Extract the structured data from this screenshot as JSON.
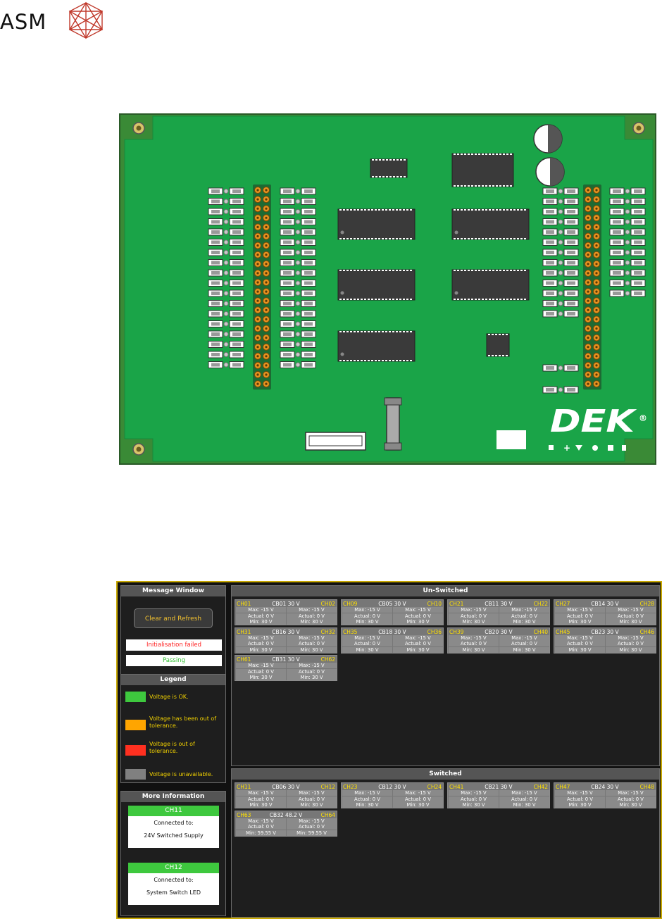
{
  "logo": {
    "text": "ASM"
  },
  "board": {
    "brand": "DEK",
    "reg_mark": "®"
  },
  "ui": {
    "message_window": {
      "title": "Message Window",
      "clear_button": "Clear and Refresh",
      "messages": [
        {
          "text": "Initialisation failed",
          "color": "#ff2020"
        },
        {
          "text": "Passing",
          "color": "#30c030"
        }
      ]
    },
    "legend": {
      "title": "Legend",
      "items": [
        {
          "color": "#3ec83e",
          "label": "Voltage is OK."
        },
        {
          "color": "#ffa500",
          "label": "Voltage has been out of tolerance."
        },
        {
          "color": "#ff3020",
          "label": "Voltage is out of tolerance."
        },
        {
          "color": "#808080",
          "label": "Voltage is unavailable."
        }
      ]
    },
    "more_info": {
      "title": "More Information",
      "items": [
        {
          "channel": "CH11",
          "connected_label": "Connected to:",
          "target": "24V Switched Supply"
        },
        {
          "channel": "CH12",
          "connected_label": "Connected to:",
          "target": "System Switch LED"
        }
      ]
    },
    "unswitched": {
      "title": "Un-Switched",
      "cards": [
        {
          "left": "CH01",
          "cb": "CB01",
          "volt": "30 V",
          "right": "CH02",
          "rows": [
            [
              "Max: -15 V",
              "Max: -15 V"
            ],
            [
              "Actual: 0 V",
              "Actual: 0 V"
            ],
            [
              "Min: 30 V",
              "Min: 30 V"
            ]
          ]
        },
        {
          "left": "CH09",
          "cb": "CB05",
          "volt": "30 V",
          "right": "CH10",
          "rows": [
            [
              "Max: -15 V",
              "Max: -15 V"
            ],
            [
              "Actual: 0 V",
              "Actual: 0 V"
            ],
            [
              "Min: 30 V",
              "Min: 30 V"
            ]
          ]
        },
        {
          "left": "CH21",
          "cb": "CB11",
          "volt": "30 V",
          "right": "CH22",
          "rows": [
            [
              "Max: -15 V",
              "Max: -15 V"
            ],
            [
              "Actual: 0 V",
              "Actual: 0 V"
            ],
            [
              "Min: 30 V",
              "Min: 30 V"
            ]
          ]
        },
        {
          "left": "CH27",
          "cb": "CB14",
          "volt": "30 V",
          "right": "CH28",
          "rows": [
            [
              "Max: -15 V",
              "Max: -15 V"
            ],
            [
              "Actual: 0 V",
              "Actual: 0 V"
            ],
            [
              "Min: 30 V",
              "Min: 30 V"
            ]
          ]
        },
        {
          "left": "CH31",
          "cb": "CB16",
          "volt": "30 V",
          "right": "CH32",
          "rows": [
            [
              "Max: -15 V",
              "Max: -15 V"
            ],
            [
              "Actual: 0 V",
              "Actual: 0 V"
            ],
            [
              "Min: 30 V",
              "Min: 30 V"
            ]
          ]
        },
        {
          "left": "CH35",
          "cb": "CB18",
          "volt": "30 V",
          "right": "CH36",
          "rows": [
            [
              "Max: -15 V",
              "Max: -15 V"
            ],
            [
              "Actual: 0 V",
              "Actual: 0 V"
            ],
            [
              "Min: 30 V",
              "Min: 30 V"
            ]
          ]
        },
        {
          "left": "CH39",
          "cb": "CB20",
          "volt": "30 V",
          "right": "CH40",
          "rows": [
            [
              "Max: -15 V",
              "Max: -15 V"
            ],
            [
              "Actual: 0 V",
              "Actual: 0 V"
            ],
            [
              "Min: 30 V",
              "Min: 30 V"
            ]
          ]
        },
        {
          "left": "CH45",
          "cb": "CB23",
          "volt": "30 V",
          "right": "CH46",
          "rows": [
            [
              "Max: -15 V",
              "Max: -15 V"
            ],
            [
              "Actual: 0 V",
              "Actual: 0 V"
            ],
            [
              "Min: 30 V",
              "Min: 30 V"
            ]
          ]
        },
        {
          "left": "CH61",
          "cb": "CB31",
          "volt": "30 V",
          "right": "CH62",
          "rows": [
            [
              "Max: -15 V",
              "Max: -15 V"
            ],
            [
              "Actual: 0 V",
              "Actual: 0 V"
            ],
            [
              "Min: 30 V",
              "Min: 30 V"
            ]
          ]
        }
      ]
    },
    "switched": {
      "title": "Switched",
      "cards": [
        {
          "left": "CH11",
          "cb": "CB06",
          "volt": "30 V",
          "right": "CH12",
          "rows": [
            [
              "Max: -15 V",
              "Max: -15 V"
            ],
            [
              "Actual: 0 V",
              "Actual: 0 V"
            ],
            [
              "Min: 30 V",
              "Min: 30 V"
            ]
          ]
        },
        {
          "left": "CH23",
          "cb": "CB12",
          "volt": "30 V",
          "right": "CH24",
          "rows": [
            [
              "Max: -15 V",
              "Max: -15 V"
            ],
            [
              "Actual: 0 V",
              "Actual: 0 V"
            ],
            [
              "Min: 30 V",
              "Min: 30 V"
            ]
          ]
        },
        {
          "left": "CH41",
          "cb": "CB21",
          "volt": "30 V",
          "right": "CH42",
          "rows": [
            [
              "Max: -15 V",
              "Max: -15 V"
            ],
            [
              "Actual: 0 V",
              "Actual: 0 V"
            ],
            [
              "Min: 30 V",
              "Min: 30 V"
            ]
          ]
        },
        {
          "left": "CH47",
          "cb": "CB24",
          "volt": "30 V",
          "right": "CH48",
          "rows": [
            [
              "Max: -15 V",
              "Max: -15 V"
            ],
            [
              "Actual: 0 V",
              "Actual: 0 V"
            ],
            [
              "Min: 30 V",
              "Min: 30 V"
            ]
          ]
        },
        {
          "left": "CH63",
          "cb": "CB32",
          "volt": "48.2 V",
          "right": "CH64",
          "rows": [
            [
              "Max: -15 V",
              "Max: -15 V"
            ],
            [
              "Actual: 0 V",
              "Actual: 0 V"
            ],
            [
              "Min: 59.55 V",
              "Min: 59.55 V"
            ]
          ]
        }
      ]
    }
  }
}
